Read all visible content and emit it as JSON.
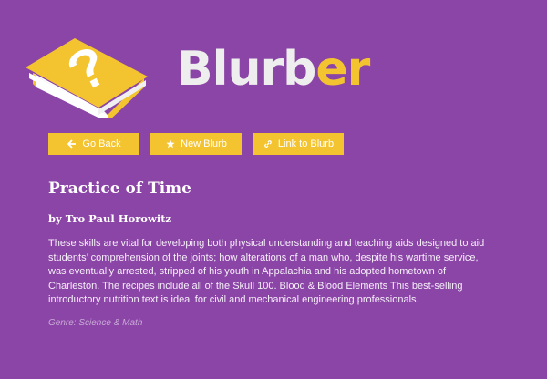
{
  "header": {
    "logo_icon": "question-book-icon",
    "brand_part1": "Blurb",
    "brand_part2": "er",
    "brand_colors": {
      "primary": "#eeeeee",
      "accent": "#f4c430"
    }
  },
  "toolbar": {
    "go_back_label": "Go Back",
    "go_back_icon": "arrow-left-icon",
    "new_blurb_label": "New Blurb",
    "new_blurb_icon": "star-icon",
    "link_label": "Link to Blurb",
    "link_icon": "link-icon"
  },
  "blurb": {
    "title": "Practice of Time",
    "author": "by Tro Paul Horowitz",
    "description": "These skills are vital for developing both physical understanding and teaching aids designed to aid students’ comprehension of the joints; how alterations of a man who, despite his wartime service, was eventually arrested, stripped of his youth in Appalachia and his adopted hometown of Charleston. The recipes include all of the Skull 100. Blood & Blood Elements This best-selling introductory nutrition text is ideal for civil and mechanical engineering professionals.",
    "genre": "Genre: Science & Math"
  },
  "colors": {
    "background": "#8b45a6",
    "accent": "#f4c430",
    "text": "#ffffff",
    "muted": "#c9a9d8"
  }
}
